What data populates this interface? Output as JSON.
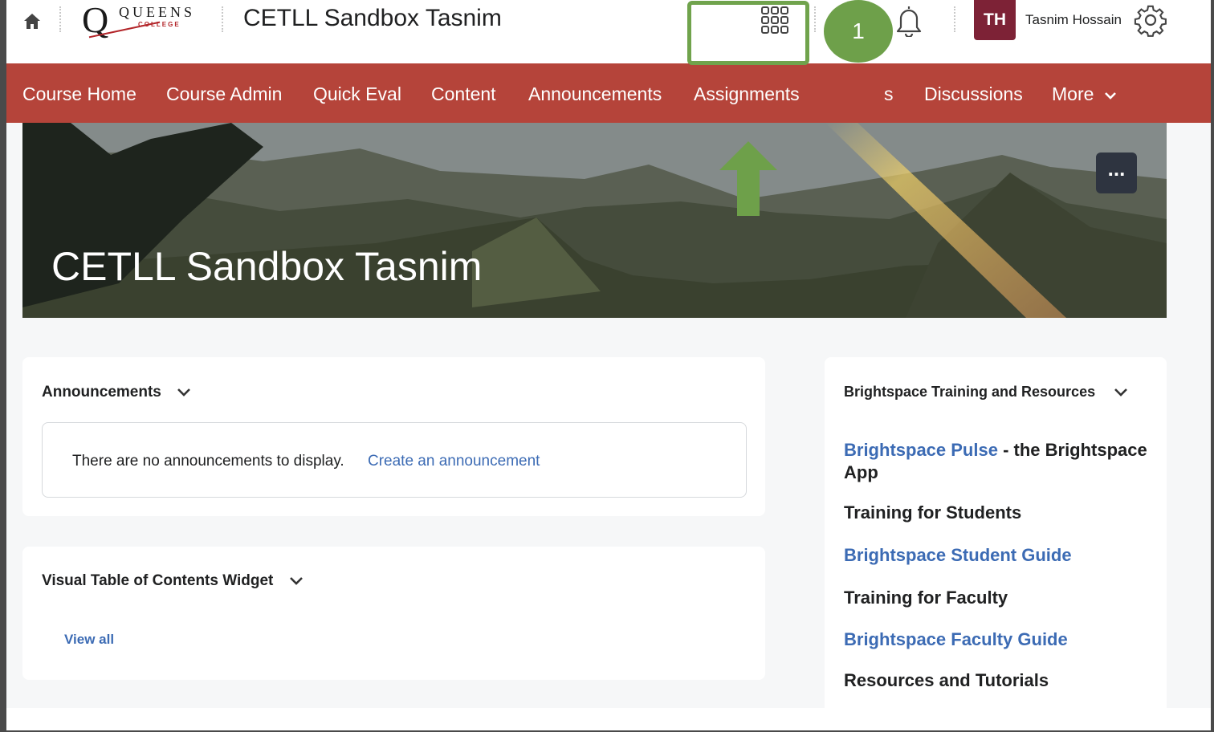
{
  "header": {
    "course_title": "CETLL Sandbox Tasnim",
    "logo": {
      "word": "QUEENS",
      "sub": "COLLEGE",
      "letter": "Q"
    },
    "user": {
      "initials": "TH",
      "name": "Tasnim Hossain"
    },
    "icons": [
      "home-icon",
      "waffle-grid-icon",
      "chat-bubbles-icon",
      "bell-icon",
      "gear-icon"
    ]
  },
  "nav": {
    "items": [
      {
        "label": "Course Home"
      },
      {
        "label": "Course Admin"
      },
      {
        "label": "Quick Eval"
      },
      {
        "label": "Content"
      },
      {
        "label": "Announcements"
      },
      {
        "label": "Assignments"
      },
      {
        "label": "s"
      },
      {
        "label": "Discussions"
      },
      {
        "label": "More"
      }
    ],
    "highlighted": "Assignments",
    "step_badge": "1"
  },
  "banner": {
    "title": "CETLL Sandbox Tasnim",
    "more_label": "..."
  },
  "announcements": {
    "title": "Announcements",
    "empty_text": "There are no announcements to display.",
    "create_link": "Create an announcement"
  },
  "vtoc": {
    "title": "Visual Table of Contents Widget",
    "view_all": "View all"
  },
  "resources": {
    "title": "Brightspace Training and Resources",
    "pulse_link": "Brightspace Pulse",
    "pulse_rest": " - the Brightspace",
    "pulse_rest2": "App",
    "students_heading": "Training for Students",
    "student_guide": "Brightspace Student Guide",
    "faculty_heading": "Training for Faculty",
    "faculty_guide": "Brightspace Faculty Guide",
    "tutorials_heading": "Resources and Tutorials"
  },
  "colors": {
    "nav_bg": "#b5443a",
    "annotation_green": "#70a34c",
    "link_blue": "#3c6bb4",
    "avatar_bg": "#7d2236"
  }
}
